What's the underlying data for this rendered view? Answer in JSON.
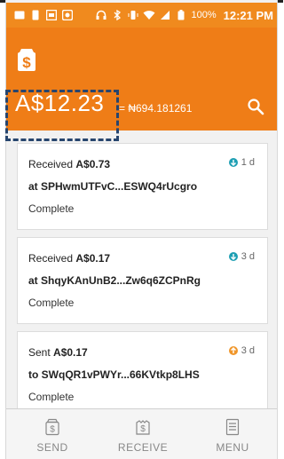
{
  "statusbar": {
    "battery": "100%",
    "time": "12:21 PM"
  },
  "header": {
    "balance": "A$12.23",
    "rate": "= ₦694.181261"
  },
  "transactions": [
    {
      "action": "Received",
      "amount": "A$0.73",
      "age": "1 d",
      "address": "at SPHwmUTFvC...ESWQ4rUcgro",
      "status": "Complete",
      "dot_color": "#1e9fb3"
    },
    {
      "action": "Received",
      "amount": "A$0.17",
      "age": "3 d",
      "address": "at ShqyKAnUnB2...Zw6q6ZCPnRg",
      "status": "Complete",
      "dot_color": "#1e9fb3"
    },
    {
      "action": "Sent",
      "amount": "A$0.17",
      "age": "3 d",
      "address": "to SWqQR1vPWYr...66KVtkp8LHS",
      "status": "Complete",
      "dot_color": "#f0962a"
    }
  ],
  "nav": {
    "send": "SEND",
    "receive": "RECEIVE",
    "menu": "MENU"
  },
  "colors": {
    "header": "#ef7d17",
    "accent_annotation": "#27456e"
  }
}
